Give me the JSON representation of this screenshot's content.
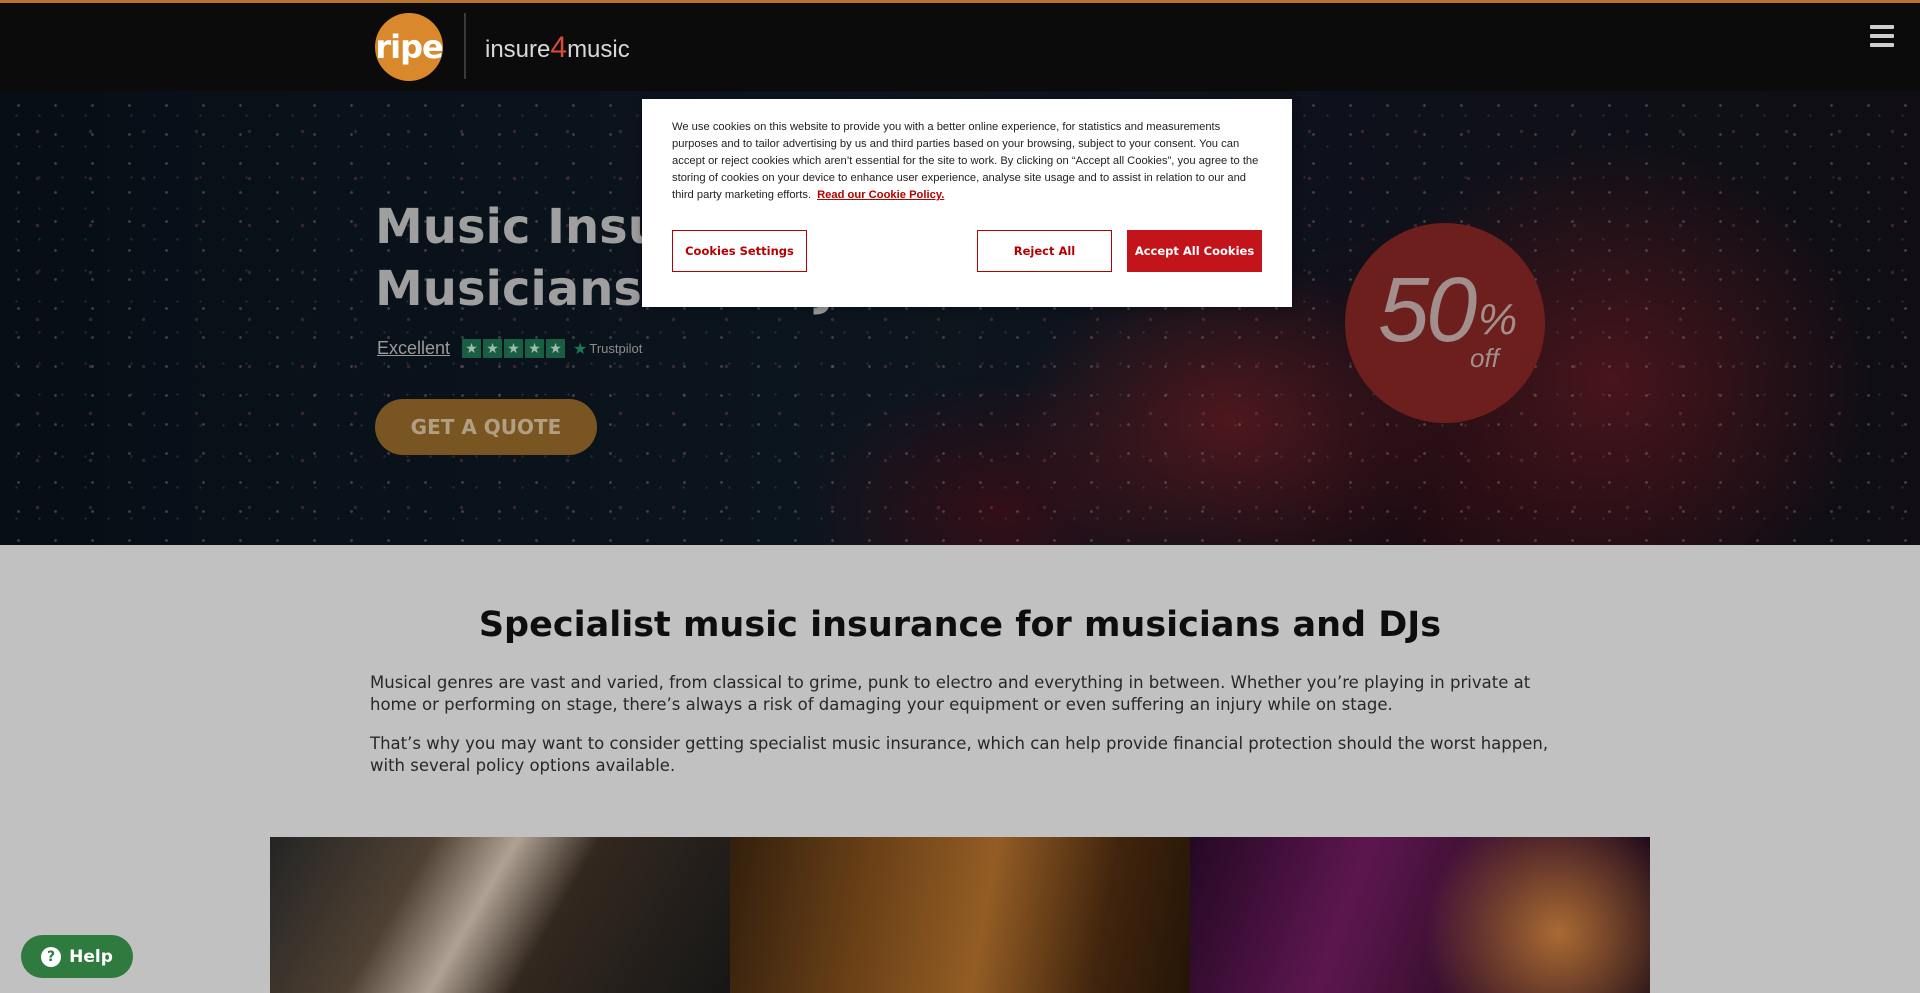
{
  "header": {
    "logo_mark": "ripe",
    "logo_text_before": "insure",
    "logo_text_num": "4",
    "logo_text_after": "music",
    "menu_icon": "hamburger-menu-icon"
  },
  "hero": {
    "title_line1": "Music Insurance for",
    "title_line2": "Musicians and DJs",
    "rating_word": "Excellent",
    "rating_stars": 5,
    "trust_brand": "Trustpilot",
    "quote_button": "GET A QUOTE",
    "badge_number": "50",
    "badge_percent": "%",
    "badge_off": "off"
  },
  "cookie_banner": {
    "text": "We use cookies on this website to provide you with a better online experience, for statistics and measurements purposes and to tailor advertising by us and third parties based on your browsing, subject to your consent. You can accept or reject cookies which aren’t essential for the site to work. By clicking on “Accept all Cookies”, you agree to the storing of cookies on your device to enhance user experience, analyse site usage and to assist in relation to our and third party marketing efforts.",
    "policy_link": "Read our Cookie Policy.",
    "settings_button": "Cookies Settings",
    "reject_button": "Reject All",
    "accept_button": "Accept All Cookies"
  },
  "main": {
    "title": "Specialist music insurance for musicians and DJs",
    "paragraph1": "Musical genres are vast and varied, from classical to grime, punk to electro and everything in between. Whether you’re playing in private at home or performing on stage, there’s always a risk of damaging your equipment or even suffering an injury while on stage.",
    "paragraph2": "That’s why you may want to consider getting specialist music insurance, which can help provide financial protection should the worst happen, with several policy options available."
  },
  "help_widget": {
    "label": "Help",
    "icon": "question-icon"
  },
  "colors": {
    "brand_orange": "#d9892b",
    "cookie_red": "#c4141b",
    "help_green": "#2f7a3e"
  }
}
